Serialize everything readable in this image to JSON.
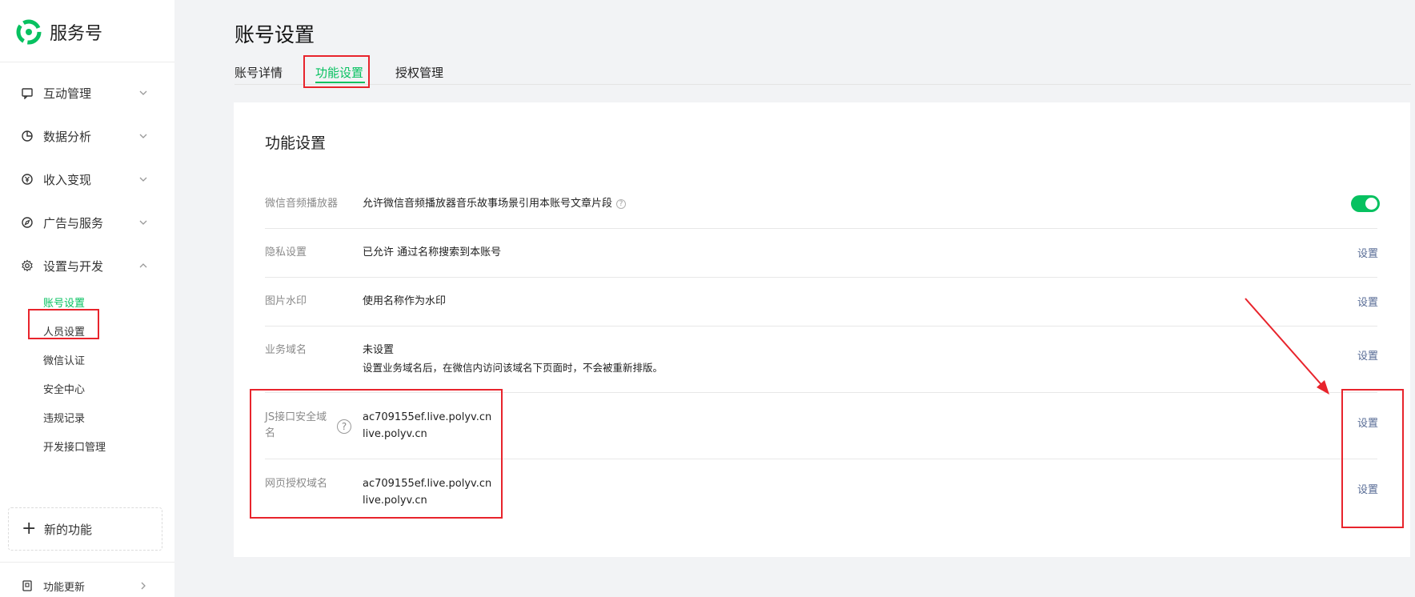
{
  "sidebar": {
    "brand": "服务号",
    "menu": [
      {
        "label": "互动管理",
        "icon": "chat-icon"
      },
      {
        "label": "数据分析",
        "icon": "pie-chart-icon"
      },
      {
        "label": "收入变现",
        "icon": "yen-icon"
      },
      {
        "label": "广告与服务",
        "icon": "compass-icon"
      },
      {
        "label": "设置与开发",
        "icon": "gear-icon"
      }
    ],
    "sub_items": [
      "账号设置",
      "人员设置",
      "微信认证",
      "安全中心",
      "违规记录",
      "开发接口管理"
    ],
    "new_feature": "新的功能",
    "feature_update": "功能更新"
  },
  "header": {
    "title": "账号设置",
    "tabs": [
      "账号详情",
      "功能设置",
      "授权管理"
    ],
    "active_tab": "功能设置"
  },
  "section": {
    "title": "功能设置",
    "rows": [
      {
        "label": "微信音频播放器",
        "value": "允许微信音频播放器音乐故事场景引用本账号文章片段",
        "control": "toggle",
        "toggle_on": true
      },
      {
        "label": "隐私设置",
        "value": "已允许 通过名称搜索到本账号",
        "action": "设置"
      },
      {
        "label": "图片水印",
        "value": "使用名称作为水印",
        "action": "设置"
      },
      {
        "label": "业务域名",
        "value": "未设置",
        "value2": "设置业务域名后，在微信内访问该域名下页面时，不会被重新排版。",
        "action": "设置"
      },
      {
        "label": "JS接口安全域名",
        "value": "ac709155ef.live.polyv.cn",
        "value2": "live.polyv.cn",
        "action": "设置"
      },
      {
        "label": "网页授权域名",
        "value": "ac709155ef.live.polyv.cn",
        "value2": "live.polyv.cn",
        "action": "设置"
      }
    ]
  },
  "colors": {
    "accent_green": "#07c160",
    "link_blue": "#576b95",
    "highlight_red": "#e8242c"
  }
}
